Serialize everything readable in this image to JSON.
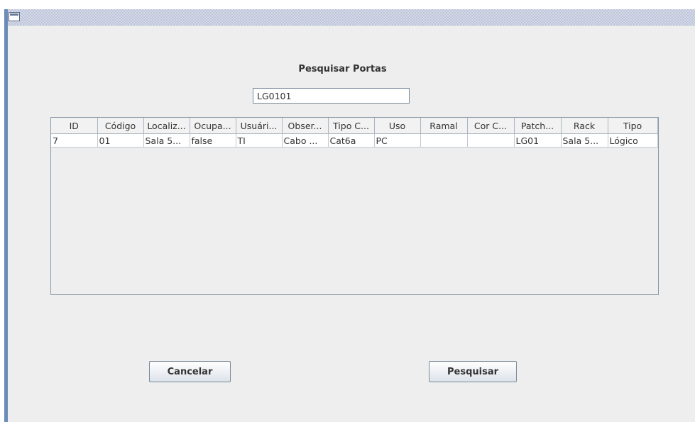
{
  "window": {
    "icon": "window-icon"
  },
  "dialog": {
    "title": "Pesquisar Portas"
  },
  "search": {
    "value": "LG0101"
  },
  "table": {
    "columns": [
      "ID",
      "Código",
      "Localiz...",
      "Ocupa...",
      "Usuári...",
      "Obser...",
      "Tipo C...",
      "Uso",
      "Ramal",
      "Cor C...",
      "Patch...",
      "Rack",
      "Tipo"
    ],
    "rows": [
      [
        "7",
        "01",
        "Sala 5...",
        "false",
        "TI",
        "Cabo ...",
        "Cat6a",
        "PC",
        "",
        "",
        "LG01",
        "Sala 5...",
        "Lógico"
      ]
    ]
  },
  "buttons": {
    "cancel": "Cancelar",
    "search": "Pesquisar"
  }
}
